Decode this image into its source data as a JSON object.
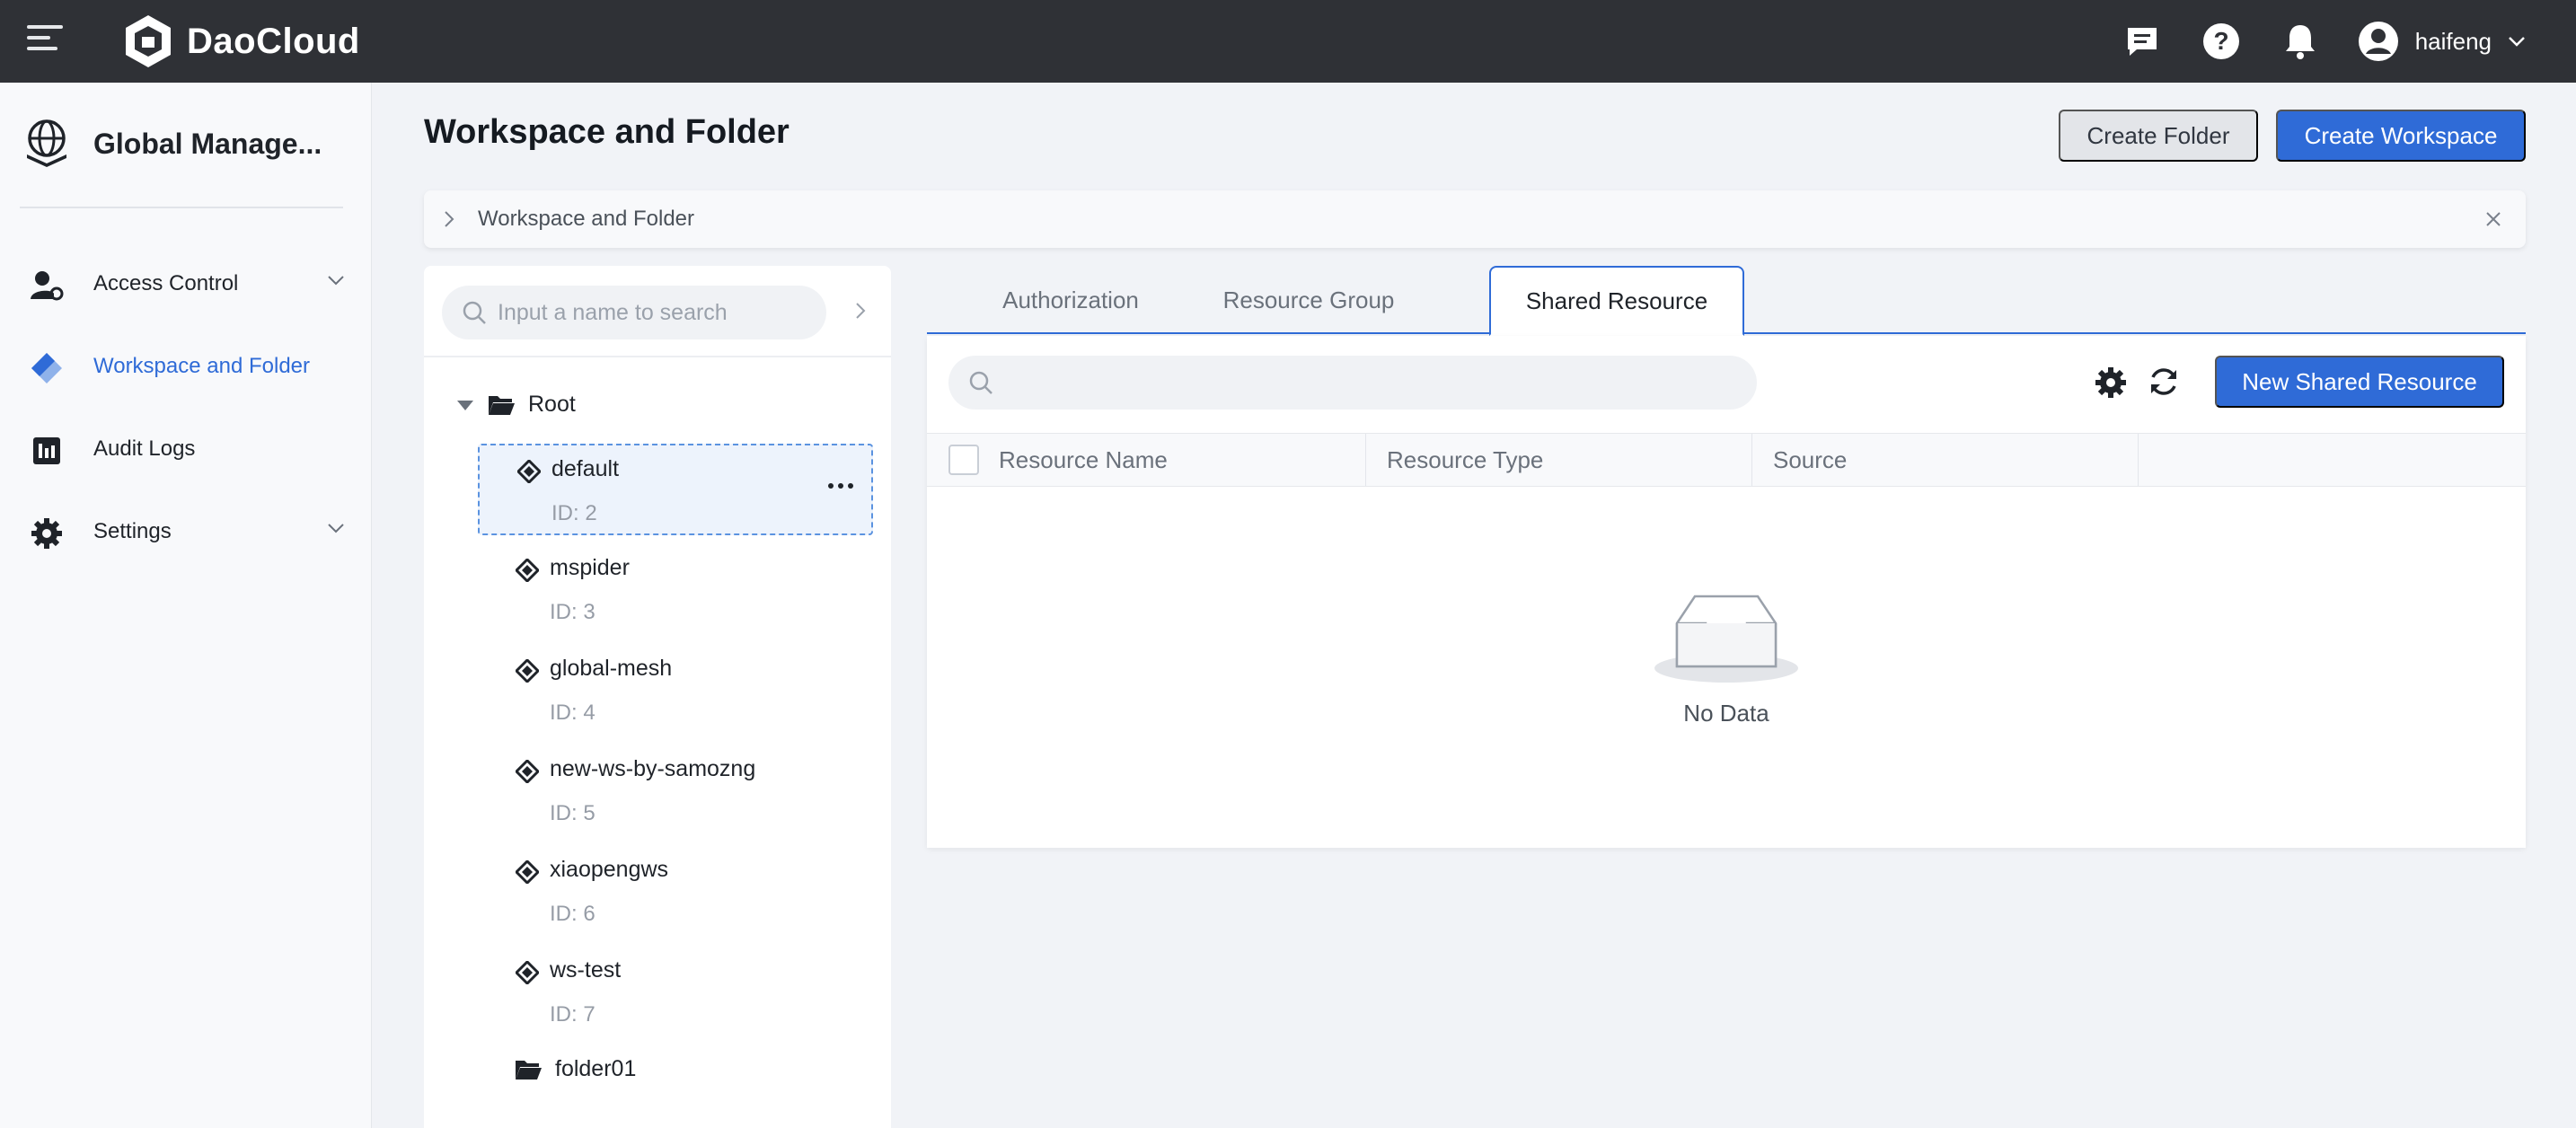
{
  "app": {
    "brand": "DaoCloud",
    "user": "haifeng"
  },
  "topbar": {
    "icons": [
      "menu-icon",
      "message-icon",
      "help-icon",
      "bell-icon",
      "user-avatar-icon",
      "chevron-down-icon"
    ]
  },
  "sidebar": {
    "module_title": "Global Manage...",
    "items": [
      {
        "label": "Access Control",
        "icon": "access-control-icon",
        "expandable": true,
        "active": false
      },
      {
        "label": "Workspace and Folder",
        "icon": "workspace-icon",
        "expandable": false,
        "active": true
      },
      {
        "label": "Audit Logs",
        "icon": "audit-logs-icon",
        "expandable": false,
        "active": false
      },
      {
        "label": "Settings",
        "icon": "gear-icon",
        "expandable": true,
        "active": false
      }
    ]
  },
  "header": {
    "title": "Workspace and Folder",
    "create_folder": "Create Folder",
    "create_workspace": "Create Workspace"
  },
  "breadcrumb": {
    "label": "Workspace and Folder"
  },
  "tree": {
    "search_placeholder": "Input a name to search",
    "root": "Root",
    "workspaces": [
      {
        "name": "default",
        "id": "ID: 2",
        "selected": true
      },
      {
        "name": "mspider",
        "id": "ID: 3",
        "selected": false
      },
      {
        "name": "global-mesh",
        "id": "ID: 4",
        "selected": false
      },
      {
        "name": "new-ws-by-samozng",
        "id": "ID: 5",
        "selected": false
      },
      {
        "name": "xiaopengws",
        "id": "ID: 6",
        "selected": false
      },
      {
        "name": "ws-test",
        "id": "ID: 7",
        "selected": false
      }
    ],
    "folder": "folder01"
  },
  "tabs": [
    {
      "label": "Authorization",
      "active": false
    },
    {
      "label": "Resource Group",
      "active": false
    },
    {
      "label": "Shared Resource",
      "active": true
    }
  ],
  "shared": {
    "search_placeholder": "",
    "new_button": "New Shared Resource",
    "columns": [
      "Resource Name",
      "Resource Type",
      "Source",
      ""
    ],
    "empty_text": "No Data"
  },
  "colors": {
    "accent": "#2f6bd7",
    "topbar": "#2f3136",
    "background": "#f1f3f7"
  }
}
